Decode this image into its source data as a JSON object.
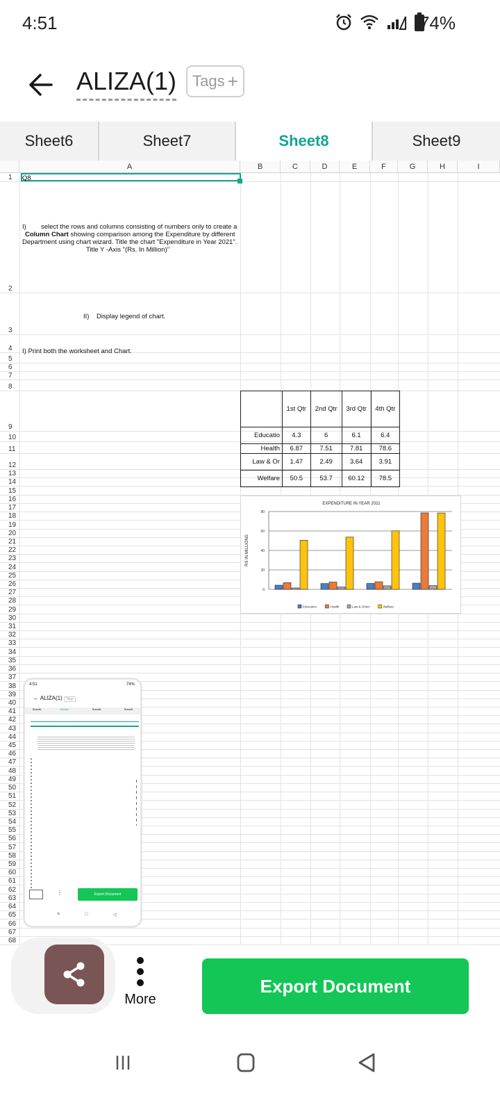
{
  "status_bar": {
    "time": "4:51",
    "battery": "74%"
  },
  "header": {
    "title": "ALIZA(1)",
    "tags_label": "Tags"
  },
  "tabs": [
    {
      "label": "Sheet6",
      "active": false
    },
    {
      "label": "Sheet7",
      "active": false
    },
    {
      "label": "Sheet8",
      "active": true
    },
    {
      "label": "Sheet9",
      "active": false
    }
  ],
  "columns": [
    "A",
    "B",
    "C",
    "D",
    "E",
    "F",
    "G",
    "H",
    "I"
  ],
  "rows": [
    "1",
    "2",
    "3",
    "4",
    "5",
    "6",
    "7",
    "8",
    "9",
    "10",
    "11",
    "12",
    "13",
    "14",
    "15",
    "16",
    "17",
    "18",
    "19",
    "20",
    "21",
    "22",
    "23",
    "24",
    "25",
    "26",
    "27",
    "28",
    "29",
    "30",
    "31",
    "32",
    "33",
    "34",
    "35",
    "36",
    "37",
    "38",
    "39",
    "40",
    "41",
    "42",
    "43",
    "44",
    "45",
    "46",
    "47",
    "48",
    "49",
    "50",
    "51",
    "52",
    "53",
    "54",
    "55",
    "56",
    "57",
    "58",
    "59",
    "60",
    "61",
    "62",
    "63",
    "64",
    "65",
    "66",
    "67",
    "68"
  ],
  "cells": {
    "a1": "Q8",
    "a2_line1_num": "I)",
    "a2_line1": "select the rows and columns consisting of numbers only to create a",
    "a2_line2_bold": "Column Chart",
    "a2_line2": "showing comparison among the Expenditure by different",
    "a2_line3": "Department using chart wizard. Title the chart \"Expenditure in Year 2021\".",
    "a2_line4": "Title Y -Axis \"(Rs. In Million)\"",
    "a3_num": "II)",
    "a3": "Display legend of chart.",
    "a4": "I) Print both the worksheet and Chart."
  },
  "table": {
    "headers": [
      "1st Qtr",
      "2nd Qtr",
      "3rd Qtr",
      "4th Qtr"
    ],
    "rows": [
      {
        "label": "Educatio",
        "values": [
          "4.3",
          "6",
          "6.1",
          "6.4"
        ]
      },
      {
        "label": "Health",
        "values": [
          "6.87",
          "7.51",
          "7.81",
          "78.6"
        ]
      },
      {
        "label": "Law & Or",
        "values": [
          "1.47",
          "2.49",
          "3.64",
          "3.91"
        ]
      },
      {
        "label": "Welfare",
        "values": [
          "50.5",
          "53.7",
          "60.12",
          "78.5"
        ]
      }
    ]
  },
  "chart_data": {
    "type": "bar",
    "title": "EXPENDITURE IN YEAR 2021",
    "ylabel": "RS IN MILLIONS",
    "xlabel": "",
    "ylim": [
      0,
      80
    ],
    "yticks": [
      0,
      20,
      40,
      60,
      80
    ],
    "categories": [
      "1st Qtr",
      "2nd Qtr",
      "3rd Qtr",
      "4th Qtr"
    ],
    "series": [
      {
        "name": "Education",
        "color": "#4a7fc0",
        "values": [
          4.3,
          6,
          6.1,
          6.4
        ]
      },
      {
        "name": "Health",
        "color": "#ec7a3a",
        "values": [
          6.87,
          7.51,
          7.81,
          78.6
        ]
      },
      {
        "name": "Law & Order",
        "color": "#a5a5a5",
        "values": [
          1.47,
          2.49,
          3.64,
          3.91
        ]
      },
      {
        "name": "Welfare",
        "color": "#ffc20e",
        "values": [
          50.5,
          53.7,
          60.12,
          78.5
        ]
      }
    ],
    "legend": "bottom",
    "grid": true
  },
  "thumbnail": {
    "time": "4:51",
    "battery": "74%",
    "title": "ALIZA(1)",
    "tags_label": "Tags",
    "tabs": [
      "Sheet6",
      "Sheet7",
      "Sheet8",
      "Sheet9"
    ],
    "export_label": "Export Document",
    "share_label": "Share",
    "more_label": "More"
  },
  "actions": {
    "more_label": "More",
    "export_label": "Export Document"
  },
  "colors": {
    "accent": "#12a592",
    "export": "#13c656",
    "share": "#7a5555"
  }
}
